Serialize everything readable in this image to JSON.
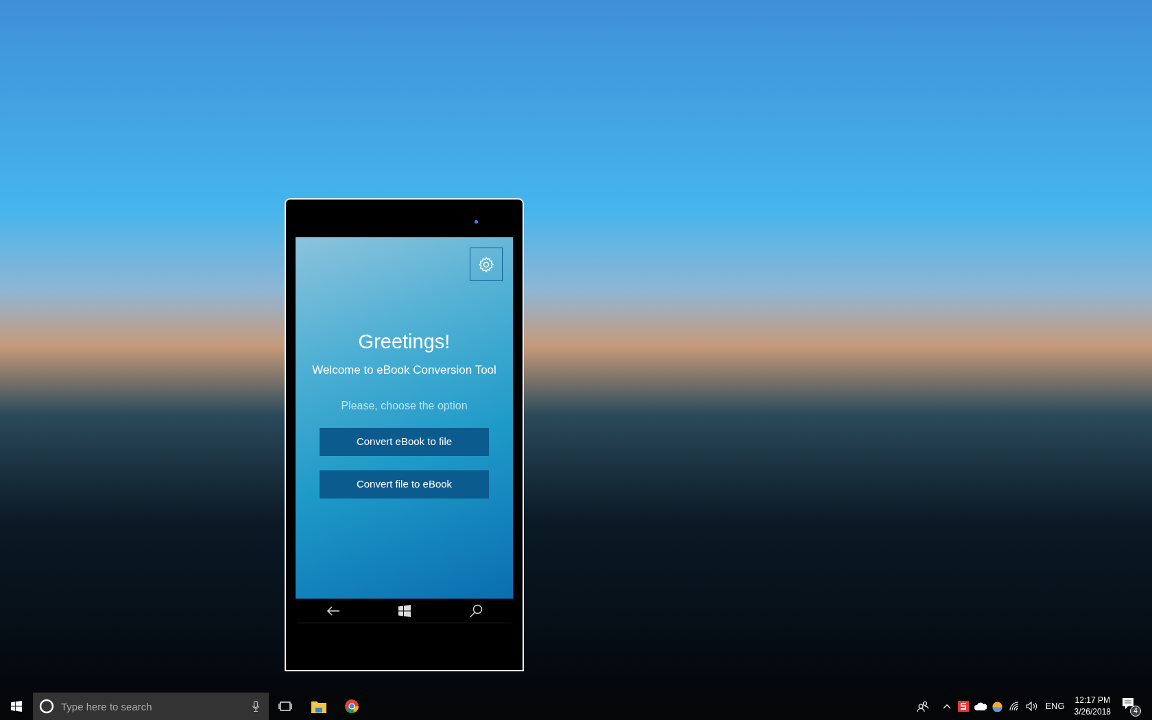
{
  "app": {
    "title": "Greetings!",
    "subtitle": "Welcome to eBook Conversion Tool",
    "prompt": "Please, choose the option",
    "buttons": [
      {
        "label": "Convert eBook to file"
      },
      {
        "label": "Convert file to eBook"
      }
    ]
  },
  "taskbar": {
    "search": {
      "placeholder": "Type here to search"
    },
    "language": "ENG",
    "time": "12:17 PM",
    "date": "3/26/2018",
    "notifications": "4"
  }
}
